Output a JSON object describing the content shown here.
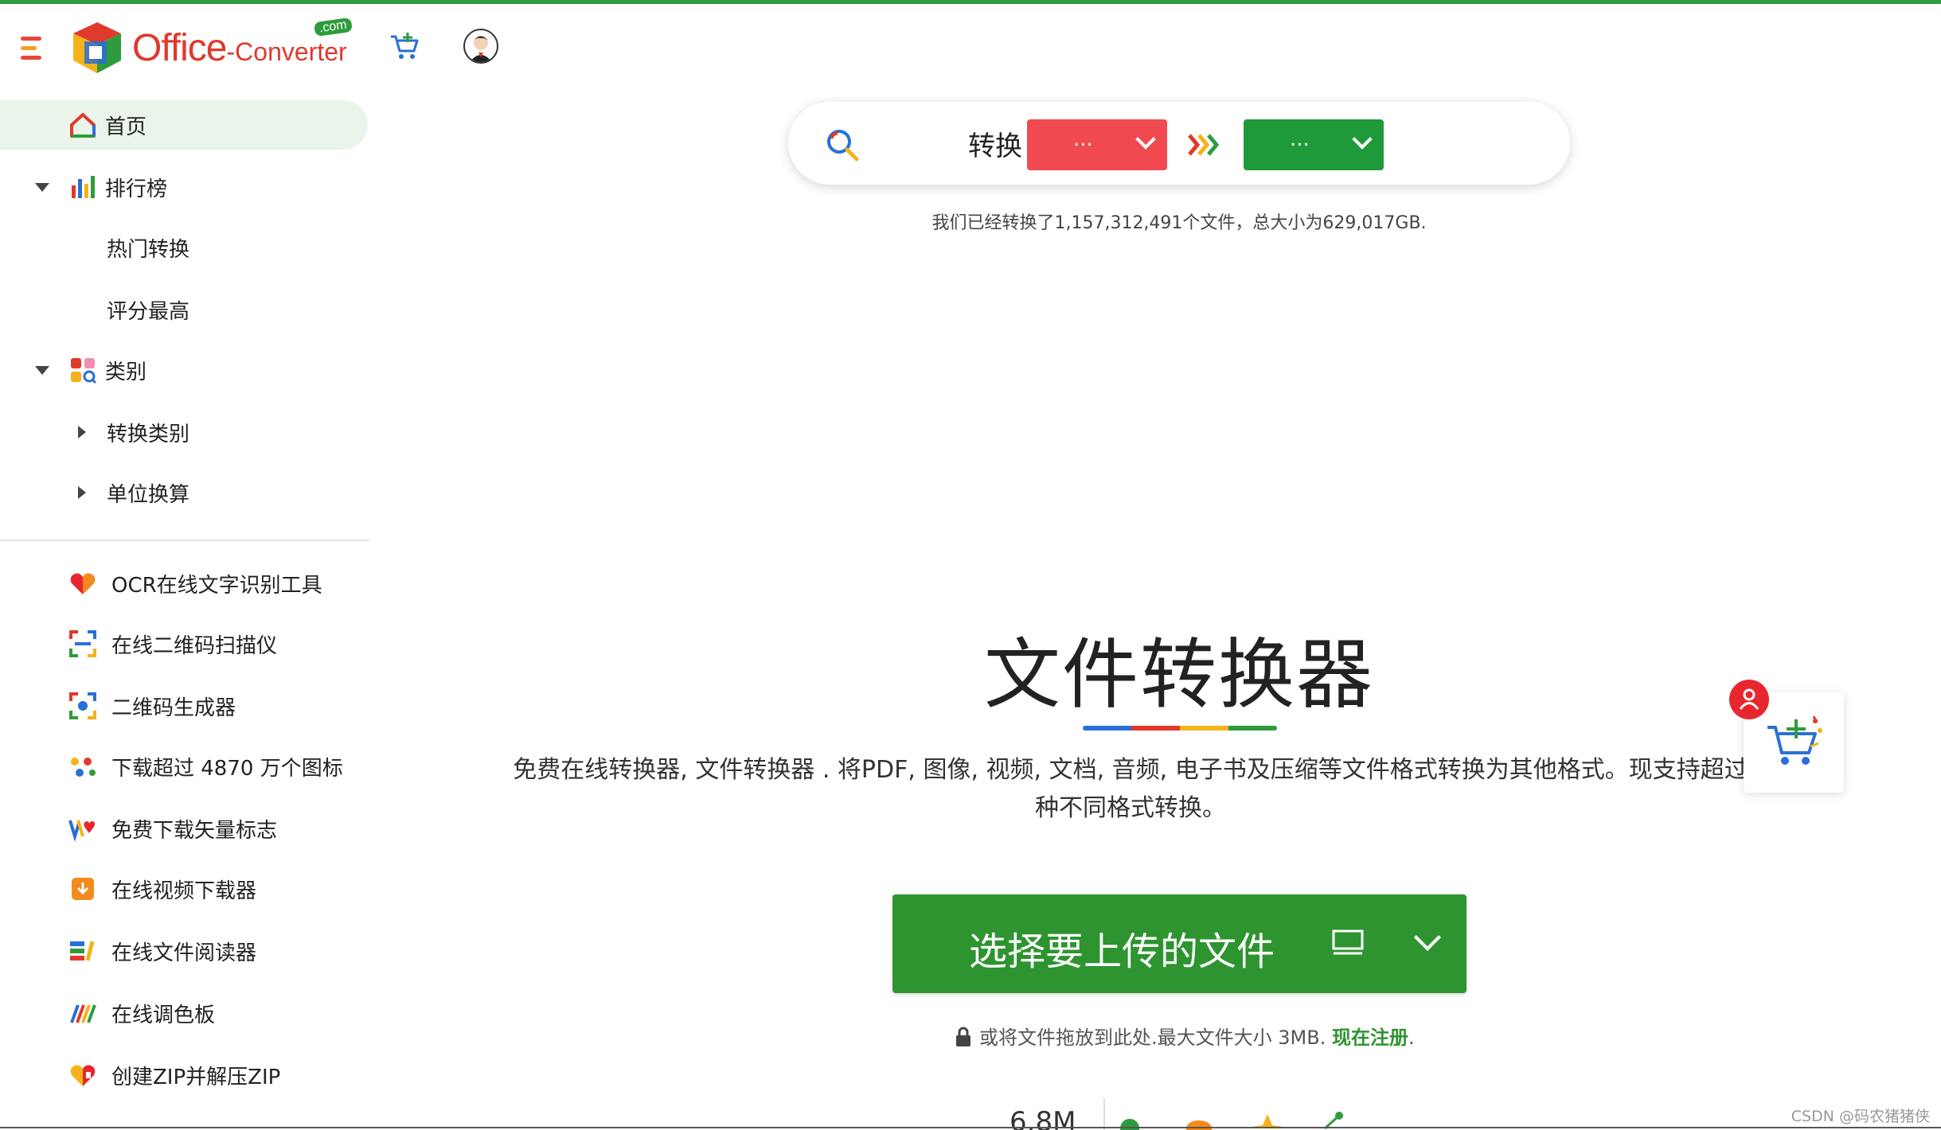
{
  "header": {
    "logo_main": "Office",
    "logo_sub": "-Converter",
    "logo_badge": ".com"
  },
  "sidebar": {
    "home": "首页",
    "ranking": "排行榜",
    "ranking_children": [
      "热门转换",
      "评分最高"
    ],
    "category": "类别",
    "category_children": [
      "转换类别",
      "单位换算"
    ],
    "tools": [
      "OCR在线文字识别工具",
      "在线二维码扫描仪",
      "二维码生成器",
      "下载超过 4870 万个图标",
      "免费下载矢量标志",
      "在线视频下载器",
      "在线文件阅读器",
      "在线调色板",
      "创建ZIP并解压ZIP"
    ]
  },
  "search": {
    "convert_label": "转换",
    "from_value": "...",
    "to_value": "...",
    "stats": "我们已经转换了1,157,312,491个文件，总大小为629,017GB."
  },
  "hero": {
    "title": "文件转换器",
    "description": "免费在线转换器, 文件转换器 . 将PDF, 图像, 视频, 文档, 音频, 电子书及压缩等文件格式转换为其他格式。现支持超过",
    "description_line2": "种不同格式转换。",
    "upload_label": "选择要上传的文件",
    "drop_note": "或将文件拖放到此处.最大文件大小 3MB.",
    "register_link": "现在注册",
    "drop_note_end": ".",
    "bottom_count": "6.8M"
  },
  "watermark": "CSDN @码农猪猪侠",
  "colors": {
    "brand_green": "#2e9430",
    "from_red": "#f04a50",
    "to_green": "#1f9a3a",
    "active_bg": "#e9f5ea"
  }
}
